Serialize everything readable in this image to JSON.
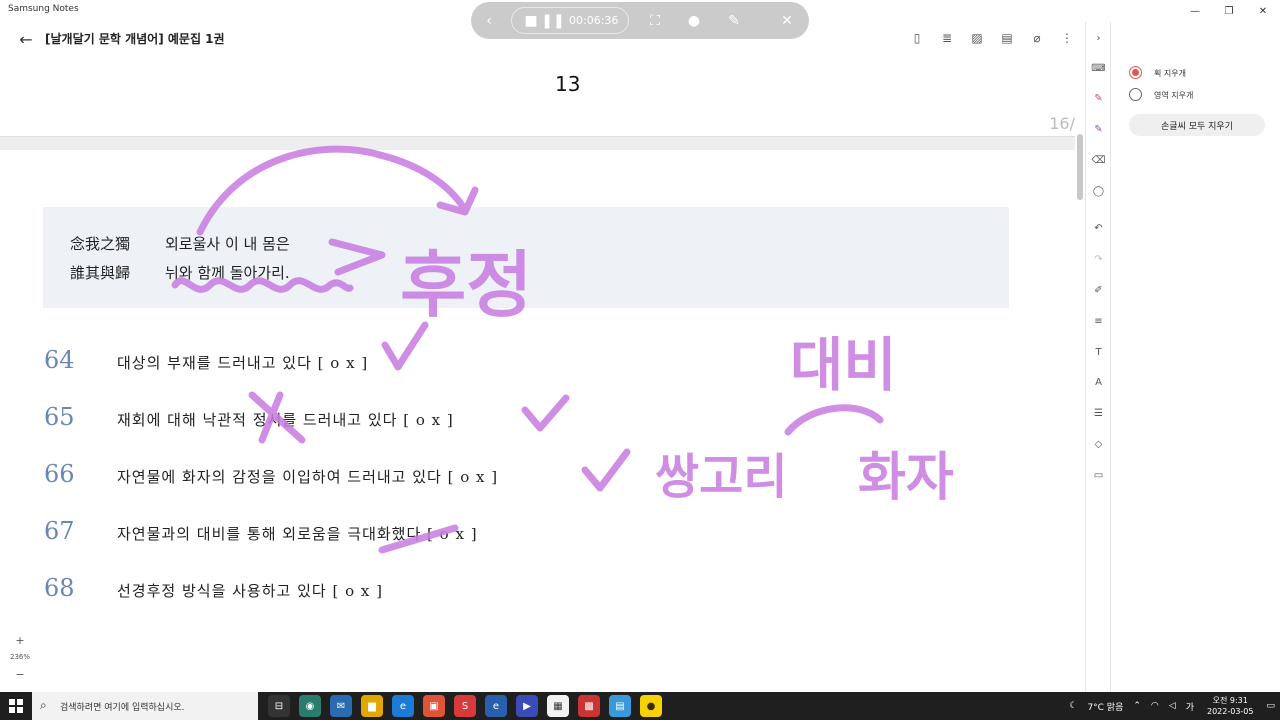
{
  "window": {
    "app_name": "Samsung Notes",
    "minimize": "—",
    "maximize": "❐",
    "close": "✕"
  },
  "recorder": {
    "time": "00:06:36"
  },
  "toolbar": {
    "title": "[날개달기 문학 개념어] 예문집 1권"
  },
  "prev_page": {
    "number": "13",
    "page_counter": "16/"
  },
  "poem": {
    "line1_hanja": "念我之獨",
    "line1_korean": "외로울사 이 내 몸은",
    "line2_hanja": "誰其與歸",
    "line2_korean": "뉘와 함께 돌아가리."
  },
  "questions": [
    {
      "num": "64",
      "text": "대상의 부재를 드러내고 있다 [ o x ]"
    },
    {
      "num": "65",
      "text": "재회에 대해 낙관적 정서를 드러내고 있다 [ o x ]"
    },
    {
      "num": "66",
      "text": "자연물에 화자의 감정을 이입하여 드러내고 있다 [ o x ]"
    },
    {
      "num": "67",
      "text": "자연물과의 대비를 통해 외로움을 극대화했다 [ o x ]"
    },
    {
      "num": "68",
      "text": "선경후정 방식을 사용하고 있다 [ o x ]"
    }
  ],
  "zoom": {
    "plus": "+",
    "level": "236%",
    "minus": "−"
  },
  "eraser_panel": {
    "option_stroke": "획 지우개",
    "option_area": "영역 지우개",
    "clear_all": "손글씨 모두 지우기"
  },
  "handwriting": {
    "huzheong": "후정",
    "daebi": "대비",
    "ssangori": "쌍고리",
    "hwaja": "화자"
  },
  "taskbar": {
    "search_placeholder": "검색하려면 여기에 입력하십시오.",
    "weather": "7°C 맑음",
    "ime": "가",
    "time": "오전 9:31",
    "date": "2022-03-05"
  },
  "colors": {
    "ink": "#c77be0",
    "number_blue": "#6a86b4",
    "poem_bg": "#eef2f7",
    "taskbar": "#1f1f1f"
  }
}
